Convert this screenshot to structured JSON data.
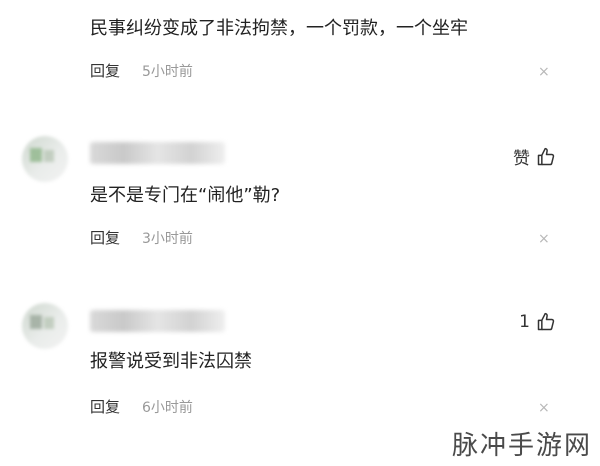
{
  "comments": [
    {
      "text": "民事纠纷变成了非法拘禁，一个罚款，一个坐牢",
      "reply_label": "回复",
      "time": "5小时前",
      "like_label": ""
    },
    {
      "text": "是不是专门在“闹他”勒?",
      "reply_label": "回复",
      "time": "3小时前",
      "like_label": "赞"
    },
    {
      "text": "报警说受到非法囚禁",
      "reply_label": "回复",
      "time": "6小时前",
      "like_label": "1"
    }
  ],
  "icons": {
    "close": "×",
    "like": "thumbs-up-icon"
  },
  "watermark": "脉冲手游网",
  "colors": {
    "text": "#222222",
    "muted": "#999999",
    "close": "#b8b8b8"
  }
}
